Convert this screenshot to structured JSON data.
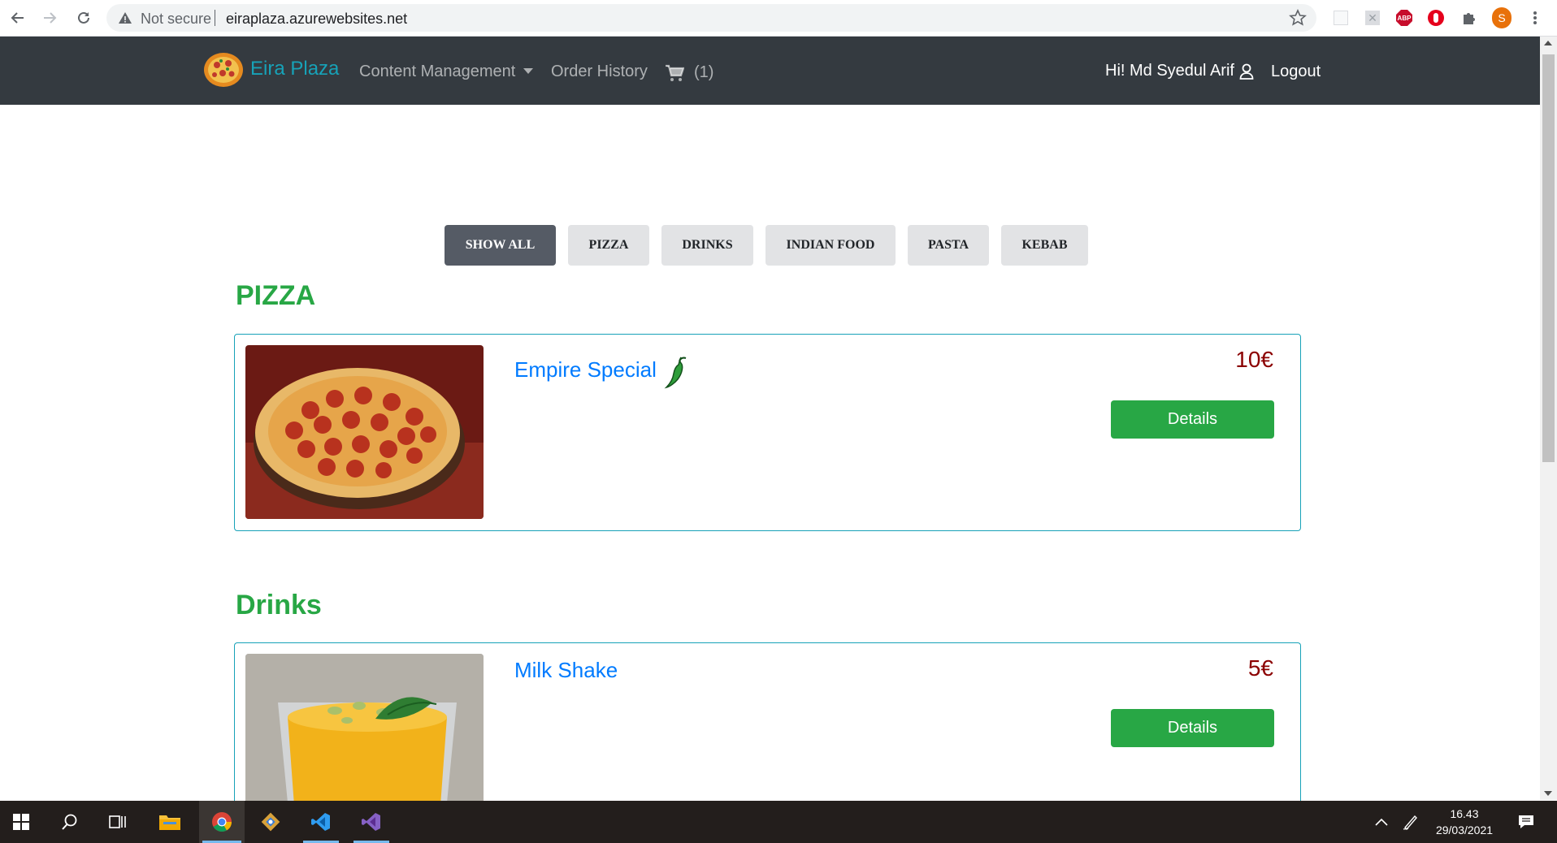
{
  "browser": {
    "security_label": "Not secure",
    "url": "eiraplaza.azurewebsites.net",
    "profile_initial": "S",
    "abp_label": "ABP"
  },
  "navbar": {
    "brand": "Eira Plaza",
    "content_management": "Content Management",
    "order_history": "Order History",
    "cart_count": "(1)",
    "greeting": "Hi! Md Syedul Arif",
    "logout": "Logout"
  },
  "filters": [
    "SHOW ALL",
    "PIZZA",
    "DRINKS",
    "INDIAN FOOD",
    "PASTA",
    "KEBAB"
  ],
  "active_filter": "SHOW ALL",
  "sections": [
    {
      "title": "PIZZA",
      "item": {
        "name": "Empire Special",
        "price": "10€",
        "details": "Details",
        "spicy_icon": "chili-pepper-icon"
      }
    },
    {
      "title": "Drinks",
      "item": {
        "name": "Milk Shake",
        "price": "5€",
        "details": "Details"
      }
    }
  ],
  "taskbar": {
    "time": "16.43",
    "date": "29/03/2021"
  },
  "colors": {
    "navbar_bg": "#343a40",
    "brand": "#17a2b8",
    "section_title": "#28a745",
    "item_name": "#007bff",
    "price": "#8b0000",
    "details_button": "#28a745",
    "card_border": "#17a2b8"
  }
}
